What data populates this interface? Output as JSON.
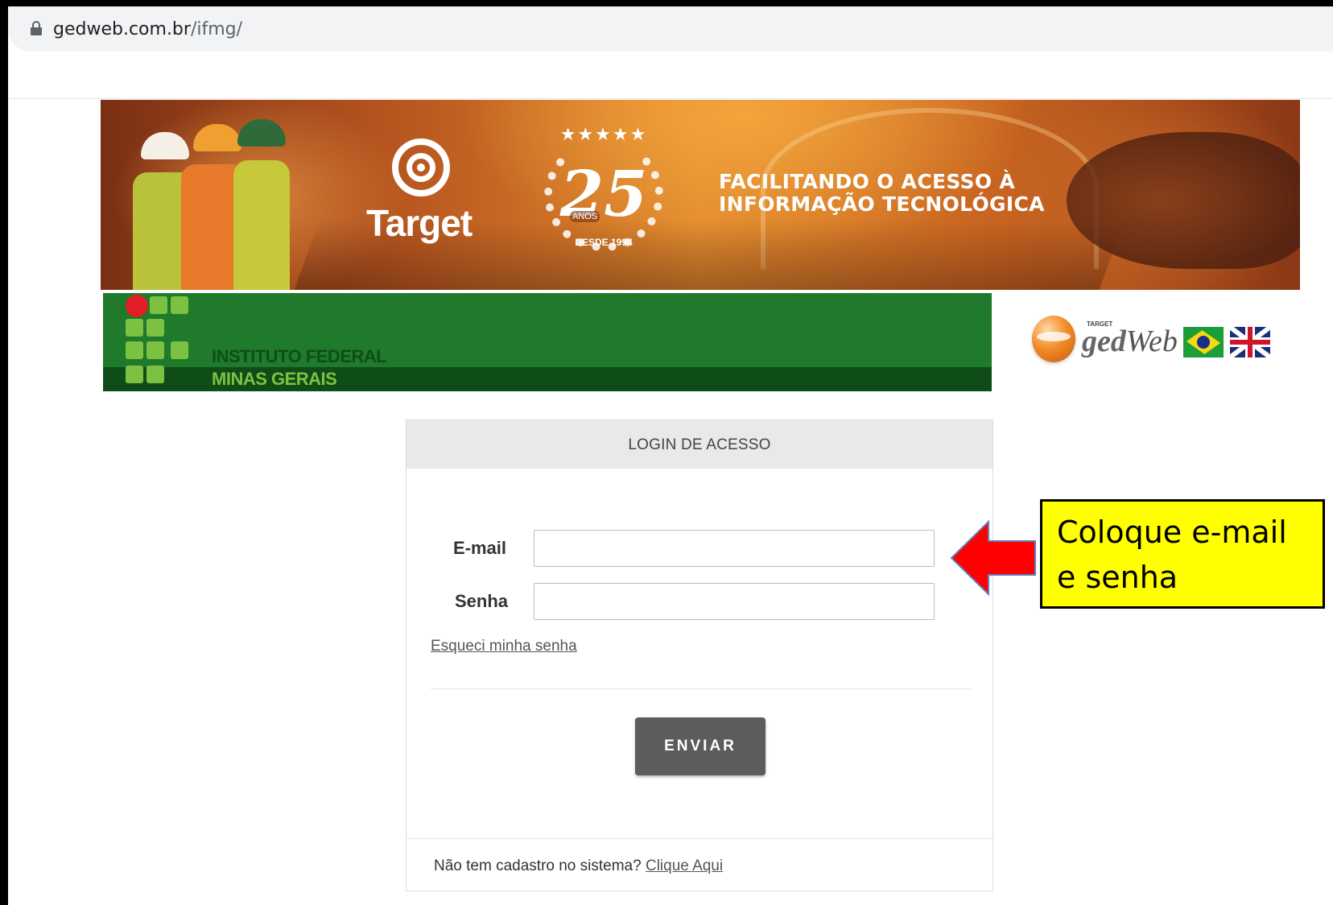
{
  "browser": {
    "url_host": "gedweb.com.br",
    "url_path": "/ifmg/"
  },
  "banner": {
    "brand": "Target",
    "anniversary_number": "25",
    "anniversary_stars": "★★★★★",
    "anniversary_anos": "ANOS",
    "anniversary_since": "DESDE 1994",
    "slogan_line1": "FACILITANDO O ACESSO À",
    "slogan_line2": "INFORMAÇÃO TECNOLÓGICA"
  },
  "institution": {
    "name_line1": "INSTITUTO FEDERAL",
    "name_line2": "MINAS GERAIS",
    "colors": {
      "green": "#1f7a2b",
      "dark_green": "#0f4d18",
      "light_green": "#7dc142",
      "red": "#e21f26"
    }
  },
  "gedweb": {
    "small_label": "TARGET",
    "logo_text_bold": "ged",
    "logo_text": "Web",
    "icons": [
      "gedweb-sphere-icon",
      "brazil-flag-icon",
      "uk-flag-icon"
    ]
  },
  "login": {
    "title": "LOGIN DE ACESSO",
    "email_label": "E-mail",
    "email_value": "",
    "password_label": "Senha",
    "password_value": "",
    "forgot_link": "Esqueci minha senha",
    "submit_label": "ENVIAR",
    "footer_text": "Não tem cadastro no sistema?",
    "footer_link": "Clique Aqui"
  },
  "annotation": {
    "callout_line1": "Coloque e-mail",
    "callout_line2": "e senha",
    "arrow_icon": "left-arrow-icon",
    "colors": {
      "callout_bg": "#ffff00",
      "arrow": "#ff0000"
    }
  }
}
